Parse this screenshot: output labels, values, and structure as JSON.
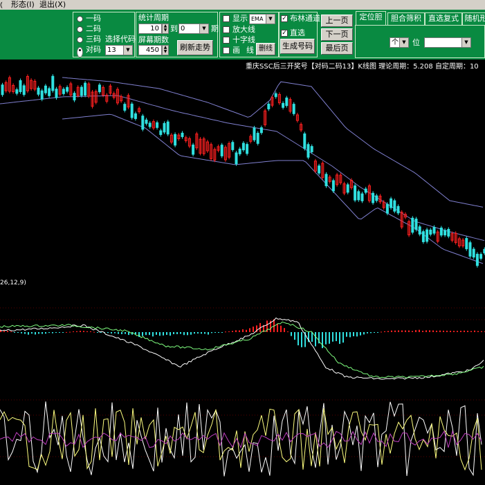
{
  "menu": {
    "items": [
      "形态(I)",
      "退出(X)"
    ],
    "left_fragment": "⦅"
  },
  "code_group": {
    "options": [
      "一码",
      "二码",
      "三码",
      "对码"
    ],
    "selected": 3,
    "select_label": "选择代码",
    "select_value": "13"
  },
  "stats": {
    "period_label": "统计周期",
    "period_value": "10",
    "period_unit_between": "到",
    "period_select": "0",
    "period_unit": "期",
    "screen_label": "屏幕期数",
    "screen_value": "450",
    "refresh_button": "刷新走势"
  },
  "options": {
    "show_label": "显示",
    "ema_value": "EMA",
    "bollinger_label": "布林通道",
    "bollinger_checked": true,
    "zoom_label": "放大线",
    "straight_label": "直选",
    "straight_checked": true,
    "cross_label": "十字线",
    "draw_label": "画",
    "line_label": "线",
    "delete_line_button": "删线",
    "generate_button": "生成号码"
  },
  "nav": {
    "prev": "上一页",
    "next": "下一页",
    "last": "最后页"
  },
  "tabs": [
    "定位胆",
    "胆合筛积",
    "直选复式",
    "随机形"
  ],
  "right_panel": {
    "select_value": "个",
    "position_label": "位"
  },
  "chart_title": "重庆SSC后三开奖号【对码二码13】K线图  理论周期：5.208  自定周期：10",
  "indicator_label": "26,12,9)",
  "colors": {
    "toolbar": "#098a41",
    "up_candle": "#ff2020",
    "down_candle": "#30e0e0",
    "band": "#8080d0",
    "dif": "#ffffff",
    "dea": "#80ff80",
    "kdj_k": "#ffffff",
    "kdj_d": "#ffff80",
    "kdj_j": "#c040c0"
  }
}
